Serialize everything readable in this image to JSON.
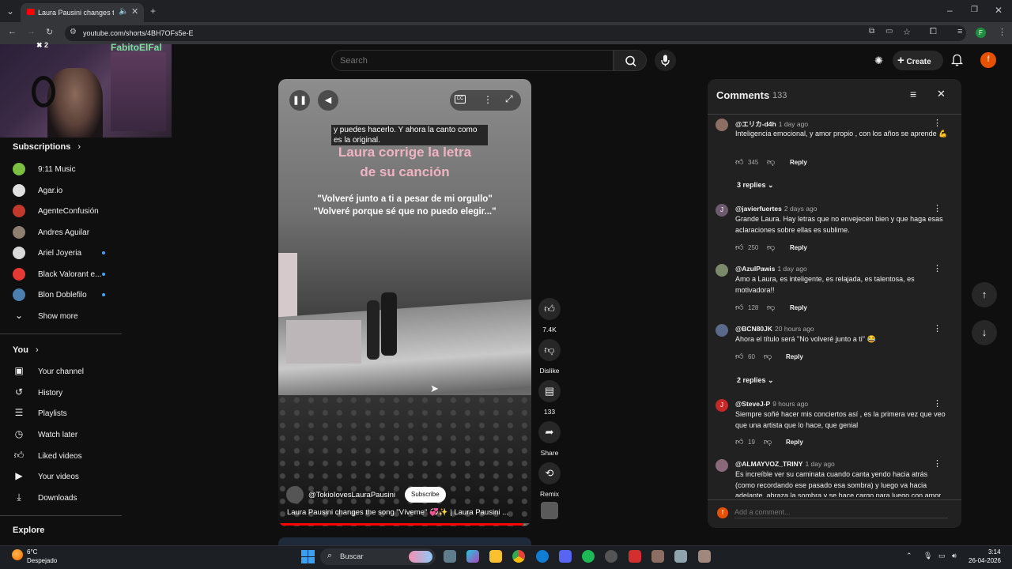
{
  "browser": {
    "tab_title": "Laura Pausini changes the s",
    "url": "youtube.com/shorts/4BH7OFs5e-E",
    "profile_initial": "F"
  },
  "webcam": {
    "streamer_name": "FabitoElFal",
    "counter": "2"
  },
  "header": {
    "search_placeholder": "Search",
    "create_label": "Create",
    "avatar_initial": "f"
  },
  "sidebar": {
    "subscriptions_title": "Subscriptions",
    "channels": [
      {
        "name": "9:11 Music",
        "color": "#7bc043",
        "new": false
      },
      {
        "name": "Agar.io",
        "color": "#e0e0e0",
        "new": false
      },
      {
        "name": "AgenteConfusión",
        "color": "#c0392b",
        "new": false
      },
      {
        "name": "Andres Aguilar",
        "color": "#8e7f70",
        "new": false
      },
      {
        "name": "Ariel Joyeria",
        "color": "#d9d9d9",
        "new": true
      },
      {
        "name": "Black Valorant e...",
        "color": "#e53935",
        "new": true
      },
      {
        "name": "Blon Doblefilo",
        "color": "#4a7fb0",
        "new": true
      }
    ],
    "show_more": "Show more",
    "you_title": "You",
    "you_items": [
      {
        "label": "Your channel",
        "icon": "person-box-icon"
      },
      {
        "label": "History",
        "icon": "history-icon"
      },
      {
        "label": "Playlists",
        "icon": "playlist-icon"
      },
      {
        "label": "Watch later",
        "icon": "clock-icon"
      },
      {
        "label": "Liked videos",
        "icon": "thumbs-up-icon"
      },
      {
        "label": "Your videos",
        "icon": "play-box-icon"
      },
      {
        "label": "Downloads",
        "icon": "download-icon"
      }
    ],
    "explore_title": "Explore"
  },
  "video": {
    "caption": "y puedes hacerlo. Y ahora la canto como es la original.",
    "title_overlay_line1": "Laura corrige la letra",
    "title_overlay_line2": "de su canción",
    "lyrics_line1": "\"Volveré junto a ti a pesar de mi orgullo\"",
    "lyrics_line2": "\"Volveré porque sé que no puedo elegir...\"",
    "channel_handle": "@TokioIovesLauraPausini",
    "subscribe_label": "Subscribe",
    "title": "Laura Pausini changes the song \"Víveme\" 💞✨ | Laura Pausini ...",
    "progress": 0.97
  },
  "actions": {
    "likes": "7.4K",
    "dislike_label": "Dislike",
    "comments_count": "133",
    "share_label": "Share",
    "remix_label": "Remix"
  },
  "comments_panel": {
    "title": "Comments",
    "count": "133",
    "reply_label": "Reply",
    "add_placeholder": "Add a comment...",
    "user_initial": "f",
    "comments": [
      {
        "author": "@エリカ-d4h",
        "time": "1 day ago",
        "text": "Inteligencia emocional, y amor propio ,  con los años se aprende 💪",
        "likes": "345",
        "avatar_color": "#8d6e63",
        "avatar_letter": "",
        "replies": "3 replies"
      },
      {
        "author": "@javierfuertes",
        "time": "2 days ago",
        "text": "Grande Laura. Hay letras que no envejecen bien y que haga esas aclaraciones sobre ellas es sublime.",
        "likes": "250",
        "avatar_color": "#6d5a6e",
        "avatar_letter": "J",
        "replies": ""
      },
      {
        "author": "@AzulPawis",
        "time": "1 day ago",
        "text": "Amo a Laura, es inteligente, es relajada, es talentosa, es motivadora!!",
        "likes": "128",
        "avatar_color": "#7a8a6a",
        "avatar_letter": "",
        "replies": ""
      },
      {
        "author": "@BCN80JK",
        "time": "20 hours ago",
        "text": "Ahora el título será \"No volveré junto a ti\" 😂",
        "likes": "60",
        "avatar_color": "#5a6a8a",
        "avatar_letter": "",
        "replies": "2 replies"
      },
      {
        "author": "@SteveJ-P",
        "time": "9 hours ago",
        "text": "Siempre soñé hacer mis conciertos así , es la primera vez que veo que una artista que lo hace, que genial",
        "likes": "19",
        "avatar_color": "#c62828",
        "avatar_letter": "J",
        "replies": ""
      },
      {
        "author": "@ALMAYVOZ_TRINY",
        "time": "1 day ago",
        "text": "Es increíble ver su caminata cuando  canta yendo hacia atrás (como recordando ese pasado esa sombra) y luego va hacia adelante, abraza la sombra y se hace cargo para luego con amor",
        "likes": "",
        "avatar_color": "#8a6a7a",
        "avatar_letter": "",
        "replies": ""
      }
    ]
  },
  "taskbar": {
    "weather_temp": "6°C",
    "weather_desc": "Despejado",
    "search_label": "Buscar",
    "time": "3:14",
    "date": "26-04-2026"
  },
  "colors": {
    "accent": "#ff0000",
    "link": "#3ea6ff",
    "background": "#0f0f0f",
    "panel": "#212121"
  }
}
